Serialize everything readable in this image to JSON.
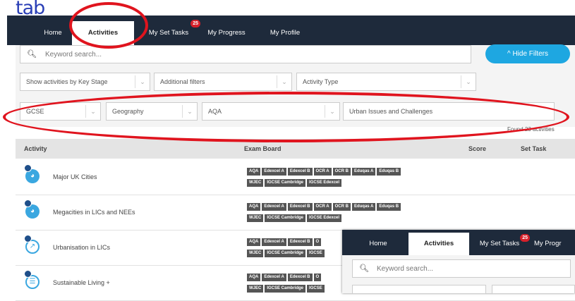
{
  "annotation": {
    "label": "tab"
  },
  "nav": {
    "tabs": [
      {
        "label": "Home"
      },
      {
        "label": "Activities"
      },
      {
        "label": "My Set Tasks",
        "badge": "25"
      },
      {
        "label": "My Progress"
      },
      {
        "label": "My Profile"
      }
    ]
  },
  "search": {
    "placeholder": "Keyword search...",
    "icon": "search-icon"
  },
  "hide_filters": {
    "label": "^ Hide Filters"
  },
  "filters_row1": [
    {
      "value": "Show activities by Key Stage"
    },
    {
      "value": "Additional filters"
    },
    {
      "value": "Activity Type"
    }
  ],
  "filters_row2": [
    {
      "value": "GCSE"
    },
    {
      "value": "Geography"
    },
    {
      "value": "AQA"
    },
    {
      "value": "Urban Issues and Challenges"
    }
  ],
  "results": {
    "text": "Found 23 activities"
  },
  "table": {
    "headers": {
      "activity": "Activity",
      "exam_board": "Exam Board",
      "score": "Score",
      "set_task": "Set Task"
    },
    "rows": [
      {
        "name": "Major UK Cities",
        "tags": [
          "AQA",
          "Edexcel A",
          "Edexcel B",
          "OCR A",
          "OCR B",
          "Eduqas A",
          "Eduqas B",
          "WJEC",
          "IGCSE Cambridge",
          "IGCSE Edexcel"
        ]
      },
      {
        "name": "Megacities in LICs and NEEs",
        "tags": [
          "AQA",
          "Edexcel A",
          "Edexcel B",
          "OCR A",
          "OCR B",
          "Eduqas A",
          "Eduqas B",
          "WJEC",
          "IGCSE Cambridge",
          "IGCSE Edexcel"
        ]
      },
      {
        "name": "Urbanisation in LICs",
        "tags": [
          "AQA",
          "Edexcel A",
          "Edexcel B",
          "O",
          "WJEC",
          "IGCSE Cambridge",
          "IGCSE"
        ]
      },
      {
        "name": "Sustainable Living +",
        "tags": [
          "AQA",
          "Edexcel A",
          "Edexcel B",
          "O",
          "WJEC",
          "IGCSE Cambridge",
          "IGCSE"
        ]
      }
    ]
  },
  "inset": {
    "tabs": [
      {
        "label": "Home"
      },
      {
        "label": "Activities"
      },
      {
        "label": "My Set Tasks",
        "badge": "25"
      },
      {
        "label": "My Progr"
      }
    ],
    "search_placeholder": "Keyword search..."
  },
  "colors": {
    "nav_bg": "#1e2a3b",
    "accent": "#1ea7e1",
    "annotation_red": "#e0141e",
    "annotation_blue": "#2a3fb6"
  }
}
